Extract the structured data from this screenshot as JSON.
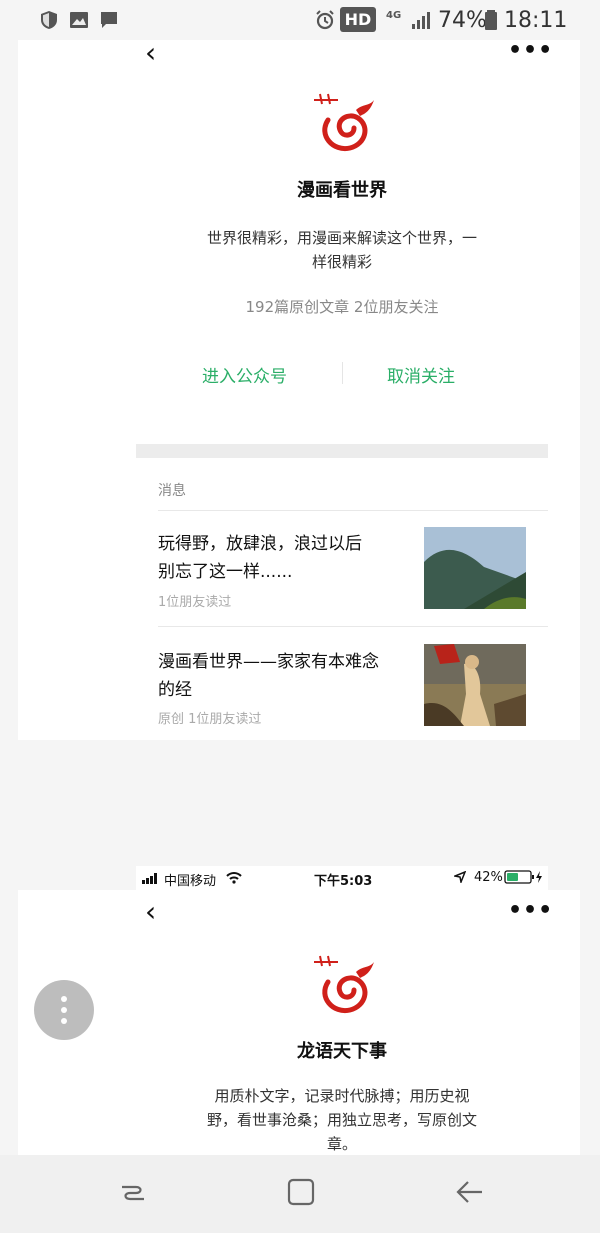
{
  "status_bar": {
    "network": "4G",
    "hd": "HD",
    "battery": "74%",
    "time": "18:11"
  },
  "top_card": {
    "account_name": "漫画看世界",
    "description_line1": "世界很精彩，用漫画来解读这个世界，一",
    "description_line2": "样很精彩",
    "stats": "192篇原创文章  2位朋友关注",
    "enter_label": "进入公众号",
    "unfollow_label": "取消关注",
    "messages_header": "消息",
    "messages": [
      {
        "title_line1": "玩得野，放肆浪，浪过以后",
        "title_line2": "别忘了这一样......",
        "meta": "1位朋友读过"
      },
      {
        "title_line1": "漫画看世界——家家有本难念",
        "title_line2": "的经",
        "meta": "原创   1位朋友读过"
      }
    ]
  },
  "ios_status": {
    "carrier": "中国移动",
    "time": "下午5:03",
    "battery": "42%"
  },
  "bottom_card": {
    "account_name": "龙语天下事",
    "description_line1": "用质朴文字，记录时代脉搏；用历史视",
    "description_line2": "野，看世事沧桑；用独立思考，写原创文",
    "description_line3": "章。"
  },
  "colors": {
    "accent_green": "#2aae67",
    "logo_red": "#d0201a"
  }
}
